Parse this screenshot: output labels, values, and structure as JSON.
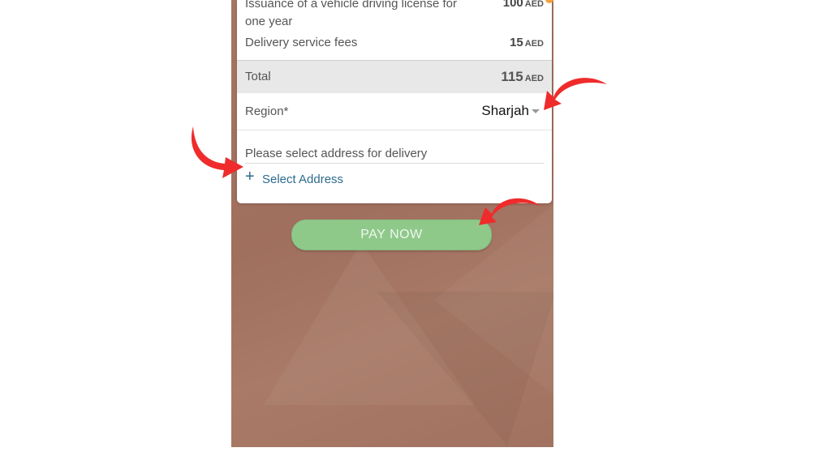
{
  "fees": {
    "license_label": "Issuance of a vehicle driving license for one year",
    "license_amount": "100",
    "delivery_label": "Delivery service fees",
    "delivery_amount": "15",
    "currency": "AED"
  },
  "total": {
    "label": "Total",
    "amount": "115",
    "currency": "AED"
  },
  "region": {
    "label": "Region",
    "required_mark": "*",
    "value": "Sharjah"
  },
  "address": {
    "prompt": "Please select address for delivery",
    "select_label": "Select Address",
    "plus_symbol": "+"
  },
  "pay_button": {
    "label": "PAY NOW"
  },
  "colors": {
    "background": "#a57663",
    "button": "#8fc98a",
    "link": "#2e6a8e",
    "arrow": "#ef2b2b"
  },
  "icons": [
    "plus-icon",
    "dropdown-caret-icon",
    "red-arrow-icon"
  ]
}
